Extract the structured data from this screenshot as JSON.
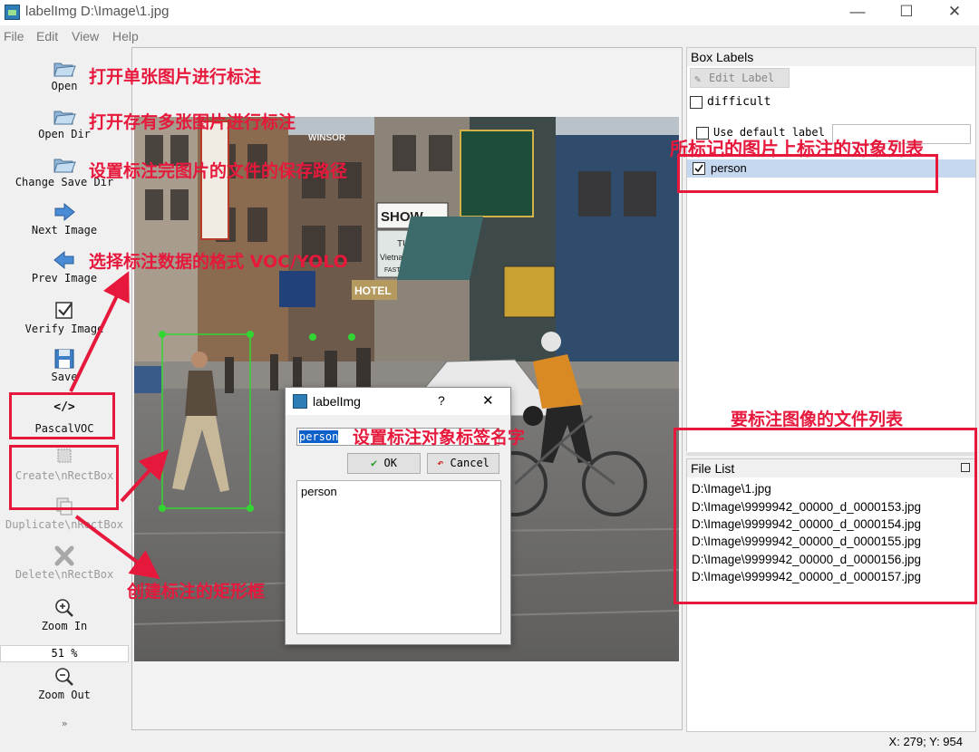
{
  "window": {
    "title": "labelImg D:\\Image\\1.jpg",
    "minimize": "—",
    "maximize": "☐",
    "close": "✕"
  },
  "menu": [
    "File",
    "Edit",
    "View",
    "Help"
  ],
  "toolbar": {
    "open": "Open",
    "open_dir": "Open Dir",
    "change_save_dir": "Change Save Dir",
    "next_image": "Next Image",
    "prev_image": "Prev Image",
    "verify_image": "Verify Image",
    "save": "Save",
    "format_icon_text": "</>",
    "format": "PascalVOC",
    "create_rectbox": "Create\\nRectBox",
    "duplicate_rectbox": "Duplicate\\nRectBox",
    "delete_rectbox": "Delete\\nRectBox",
    "zoom_in": "Zoom In",
    "zoom_value": "51 %",
    "zoom_out": "Zoom Out",
    "more": "»"
  },
  "box_labels": {
    "title": "Box Labels",
    "edit_label": "Edit Label",
    "difficult": "difficult",
    "use_default_label": "Use default label",
    "labels": [
      {
        "text": "person",
        "checked": true
      }
    ]
  },
  "file_list": {
    "title": "File List",
    "files": [
      "D:\\Image\\1.jpg",
      "D:\\Image\\9999942_00000_d_0000153.jpg",
      "D:\\Image\\9999942_00000_d_0000154.jpg",
      "D:\\Image\\9999942_00000_d_0000155.jpg",
      "D:\\Image\\9999942_00000_d_0000156.jpg",
      "D:\\Image\\9999942_00000_d_0000157.jpg"
    ]
  },
  "status": "X: 279; Y: 954",
  "dialog": {
    "title": "labelImg",
    "help": "?",
    "close": "✕",
    "input_value": "person",
    "ok": "OK",
    "cancel": "Cancel",
    "list": [
      "person"
    ]
  },
  "photo_signs": {
    "show": "SHOW",
    "hotel": "HOTEL",
    "tulan": "TU LAN",
    "tulan_sub": "Vietnamese Fo",
    "tulan_fast": "FAST FOOD TO",
    "winsor": "WINSOR",
    "hotel_small": "HOTEL"
  },
  "annotations": {
    "open": "打开单张图片进行标注",
    "open_dir": "打开存有多张图片进行标注",
    "save_dir": "设置标注完图片的文件的保存路径",
    "format": "选择标注数据的格式 VOC/YOLO",
    "create": "创建标注的矩形框",
    "dialog": "设置标注对象标签名字",
    "box_labels": "所标记的图片上标注的对象列表",
    "file_list": "要标注图像的文件列表"
  },
  "colors": {
    "annotation_red": "#e6193d",
    "bbox_green": "#32d632",
    "selection_blue": "#0a5fc8",
    "label_row": "#c6d7f0"
  }
}
